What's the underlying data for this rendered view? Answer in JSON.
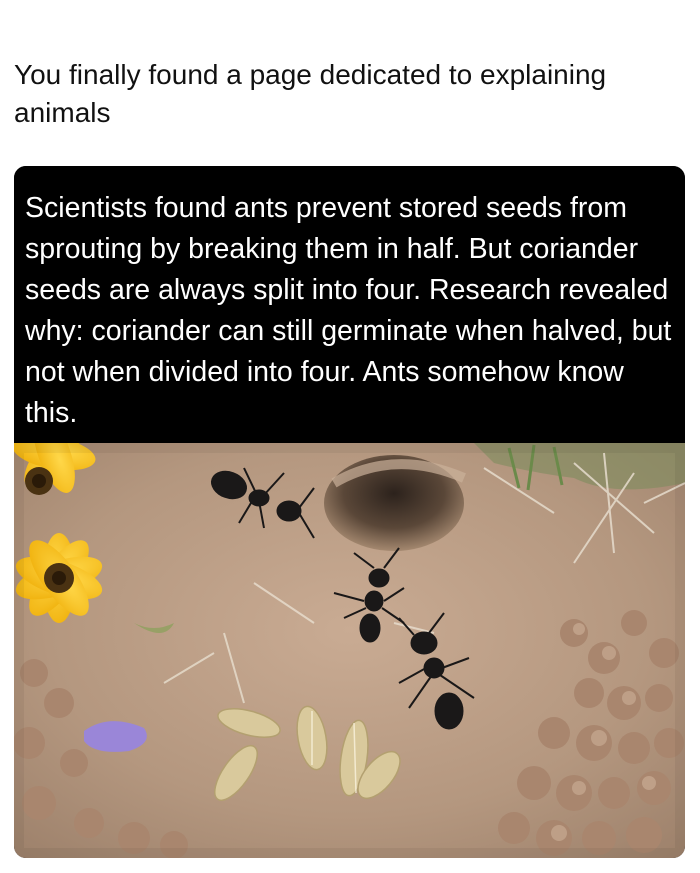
{
  "post": {
    "text": "You finally found a page dedicated to explaining animals"
  },
  "meme": {
    "caption": "Scientists found ants prevent stored seeds from sprouting by breaking them in half. But coriander seeds are always split into four. Research revealed why: coriander can still germinate when halved, but not when divided into four. Ants somehow know this."
  },
  "colors": {
    "caption_background": "#000000",
    "caption_text": "#ffffff",
    "soil": "#b89a82",
    "flower": "#f6c21a",
    "ant": "#1a1818",
    "seed": "#d8c79a",
    "petal": "#9a86d8"
  }
}
